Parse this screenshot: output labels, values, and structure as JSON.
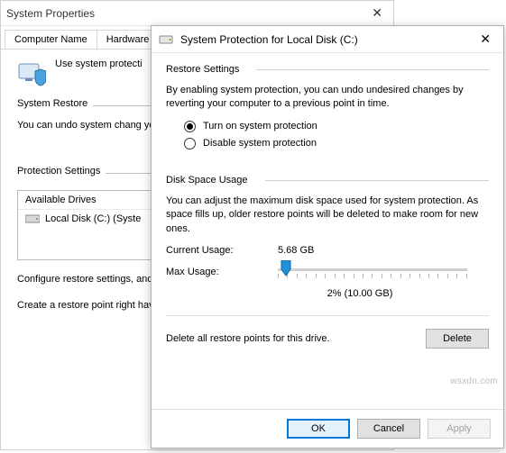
{
  "sysprops": {
    "title": "System Properties",
    "tabs": [
      "Computer Name",
      "Hardware"
    ],
    "intro": "Use system protecti",
    "group_restore": {
      "legend": "System Restore",
      "text": "You can undo system chang your computer to a previous"
    },
    "group_protect": {
      "legend": "Protection Settings",
      "drives_header": "Available Drives",
      "drive_item": "Local Disk (C:) (Syste",
      "desc1": "Configure restore settings, and delete restore points.",
      "desc2": "Create a restore point right have system protection tur"
    }
  },
  "protect": {
    "title": "System Protection for Local Disk (C:)",
    "restore": {
      "title": "Restore Settings",
      "text": "By enabling system protection, you can undo undesired changes by reverting your computer to a previous point in time.",
      "opt_on": "Turn on system protection",
      "opt_off": "Disable system protection"
    },
    "disk": {
      "title": "Disk Space Usage",
      "text": "You can adjust the maximum disk space used for system protection. As space fills up, older restore points will be deleted to make room for new ones.",
      "current_label": "Current Usage:",
      "current_value": "5.68 GB",
      "max_label": "Max Usage:",
      "usage_value": "2% (10.00 GB)"
    },
    "delete": {
      "text": "Delete all restore points for this drive.",
      "btn": "Delete"
    },
    "footer": {
      "ok": "OK",
      "cancel": "Cancel",
      "apply": "Apply"
    }
  },
  "watermark": "wsxdn.com"
}
